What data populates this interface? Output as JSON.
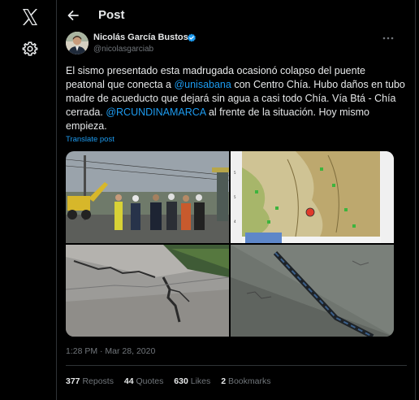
{
  "nav": {
    "logo_icon": "x-logo-icon",
    "settings_icon": "gear-icon"
  },
  "header": {
    "title": "Post",
    "back_icon": "arrow-left-icon"
  },
  "post": {
    "author_name": "Nicolás García Bustos",
    "handle": "@nicolasgarciab",
    "verified": true,
    "text_segments": [
      {
        "t": "El sismo presentado esta madrugada ocasionó colapso del puente peatonal que conecta a ",
        "link": false
      },
      {
        "t": "@unisabana",
        "link": true
      },
      {
        "t": " con Centro Chía. Hubo daños en tubo madre de acueducto que dejará sin agua a casi todo Chía. Vía Btá - Chía cerrada. ",
        "link": false
      },
      {
        "t": "@RCUNDINAMARCA",
        "link": true
      },
      {
        "t": " al frente de la situación. Hoy mismo empieza.",
        "link": false
      }
    ],
    "translate_label": "Translate post",
    "media": [
      {
        "name": "photo-bridge-site-workers"
      },
      {
        "name": "photo-seismic-map"
      },
      {
        "name": "photo-cracked-pavement"
      },
      {
        "name": "photo-pipe-damage"
      }
    ],
    "timestamp": "1:28 PM · Mar 28, 2020"
  },
  "stats": {
    "reposts_count": "377",
    "reposts_label": "Reposts",
    "quotes_count": "44",
    "quotes_label": "Quotes",
    "likes_count": "630",
    "likes_label": "Likes",
    "bookmarks_count": "2",
    "bookmarks_label": "Bookmarks"
  },
  "colors": {
    "accent": "#1d9bf0",
    "muted": "#71767b",
    "text": "#e7e9ea",
    "border": "#2f3336"
  }
}
